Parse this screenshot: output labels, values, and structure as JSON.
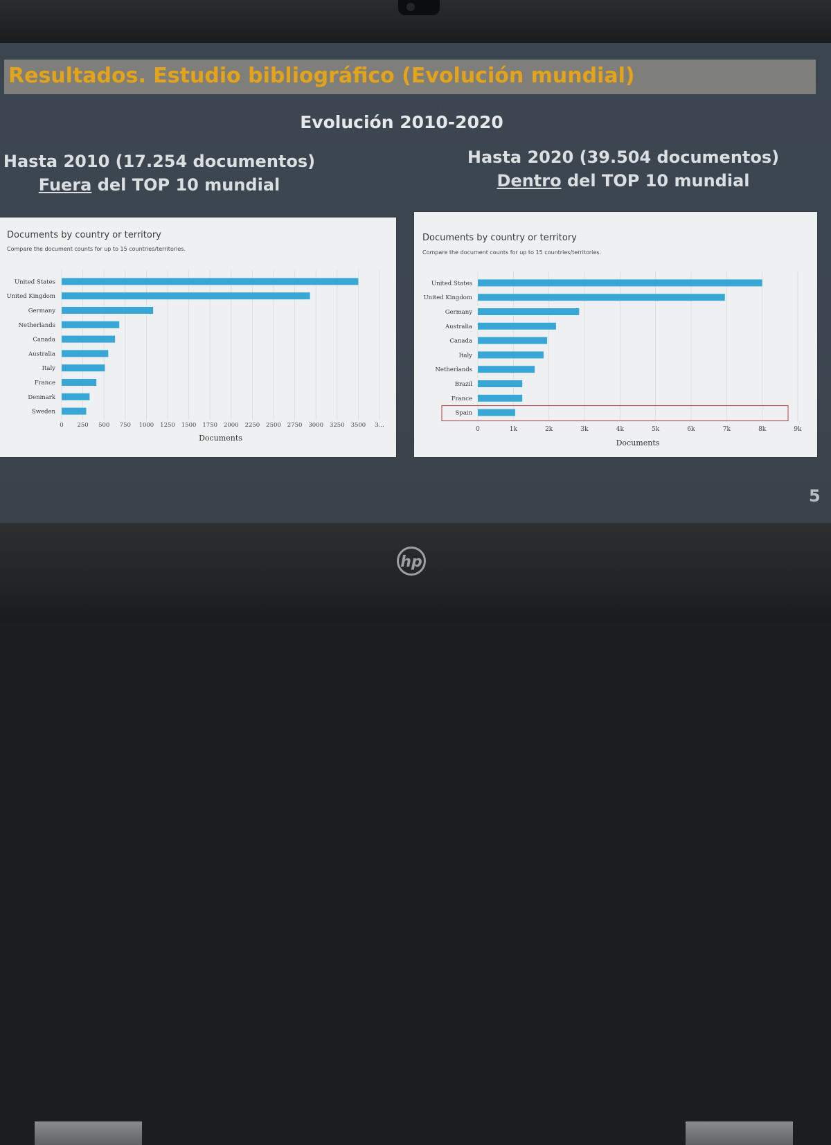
{
  "slide": {
    "title": "Resultados. Estudio bibliográfico (Evolución mundial)",
    "subtitle": "Evolución 2010-2020",
    "left_header_line1": "Hasta 2010 (17.254 documentos)",
    "left_header_emph": "Fuera",
    "left_header_rest": " del TOP 10 mundial",
    "right_header_line1": "Hasta 2020 (39.504 documentos)",
    "right_header_emph": "Dentro",
    "right_header_rest": " del TOP 10 mundial",
    "page_number": "5"
  },
  "device": {
    "logo": "hp"
  },
  "charts": {
    "left": {
      "title": "Documents by country or territory",
      "subtitle": "Compare the document counts for up to 15 countries/territories."
    },
    "right": {
      "title": "Documents by country or territory",
      "subtitle": "Compare the document counts for up to 15 countries/territories."
    }
  },
  "chart_data": [
    {
      "type": "bar",
      "orientation": "horizontal",
      "title": "Documents by country or territory",
      "xlabel": "Documents",
      "categories": [
        "United States",
        "United Kingdom",
        "Germany",
        "Netherlands",
        "Canada",
        "Australia",
        "Italy",
        "France",
        "Denmark",
        "Sweden"
      ],
      "values": [
        3500,
        2930,
        1080,
        680,
        630,
        550,
        510,
        410,
        330,
        290
      ],
      "xticks": [
        "0",
        "250",
        "500",
        "750",
        "1000",
        "1250",
        "1500",
        "1750",
        "2000",
        "2250",
        "2500",
        "2750",
        "3000",
        "3250",
        "3500",
        "3..."
      ],
      "xlim": [
        0,
        3750
      ],
      "bar_color": "#39a7d6",
      "grid": true
    },
    {
      "type": "bar",
      "orientation": "horizontal",
      "title": "Documents by country or territory",
      "xlabel": "Documents",
      "categories": [
        "United States",
        "United Kingdom",
        "Germany",
        "Australia",
        "Canada",
        "Italy",
        "Netherlands",
        "Brazil",
        "France",
        "Spain"
      ],
      "values": [
        8000,
        6950,
        2850,
        2200,
        1950,
        1850,
        1600,
        1250,
        1250,
        1050
      ],
      "xticks": [
        "0",
        "1k",
        "2k",
        "3k",
        "4k",
        "5k",
        "6k",
        "7k",
        "8k",
        "9k"
      ],
      "xlim": [
        0,
        9000
      ],
      "bar_color": "#39a7d6",
      "highlight_category": "Spain",
      "highlight_color": "#b84040",
      "grid": true
    }
  ]
}
